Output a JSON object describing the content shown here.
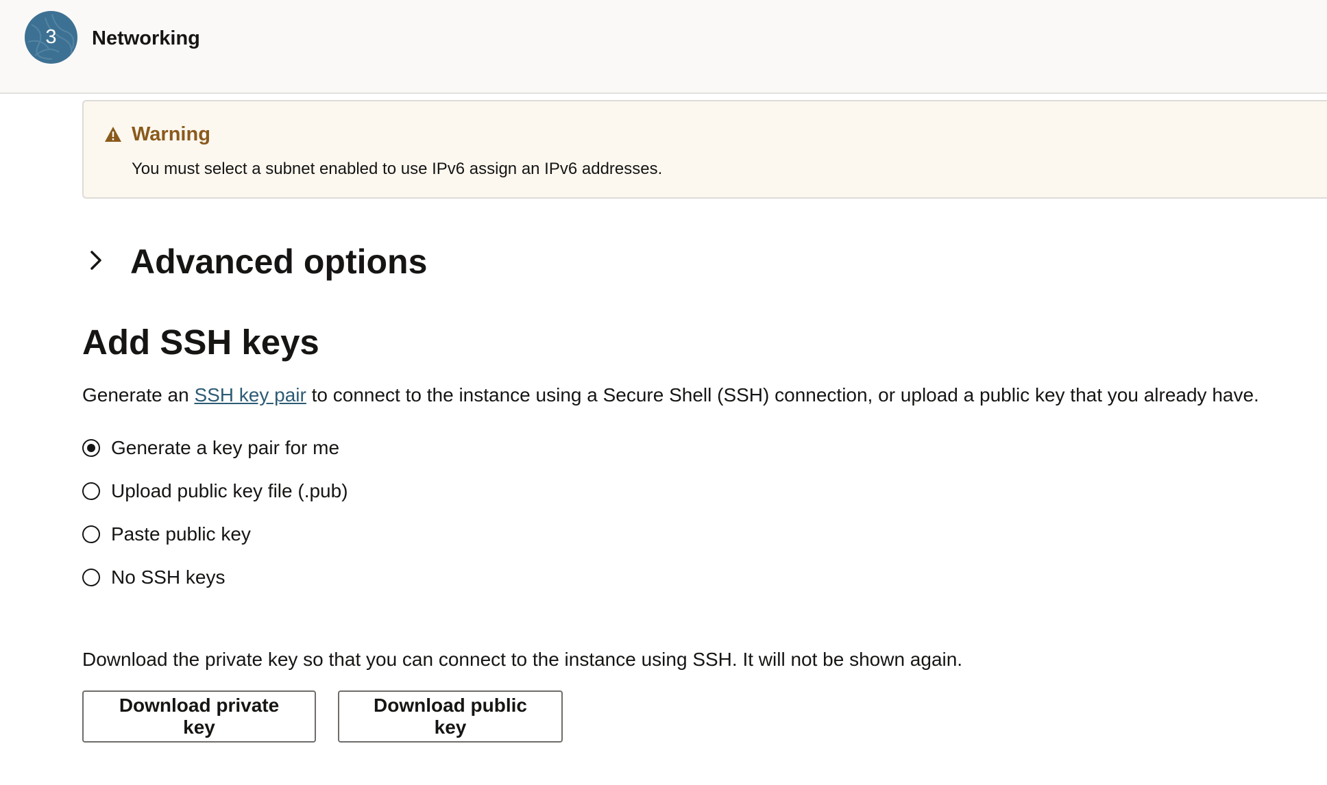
{
  "header": {
    "step_number": "3",
    "step_title": "Networking"
  },
  "warning": {
    "icon": "warning-triangle-icon",
    "title": "Warning",
    "message": "You must select a subnet enabled to use IPv6 assign an IPv6 addresses."
  },
  "advanced": {
    "icon": "chevron-right-icon",
    "title": "Advanced options"
  },
  "ssh": {
    "title": "Add SSH keys",
    "desc_before": "Generate an ",
    "desc_link": "SSH key pair",
    "desc_after": " to connect to the instance using a Secure Shell (SSH) connection, or upload a public key that you already have.",
    "options": [
      {
        "label": "Generate a key pair for me",
        "selected": true
      },
      {
        "label": "Upload public key file (.pub)",
        "selected": false
      },
      {
        "label": "Paste public key",
        "selected": false
      },
      {
        "label": "No SSH keys",
        "selected": false
      }
    ],
    "download_note": "Download the private key so that you can connect to the instance using SSH. It will not be shown again.",
    "download_private_label": "Download private key",
    "download_public_label": "Download public key"
  },
  "colors": {
    "step_circle": "#3d7193",
    "warning_title": "#8a5a1c",
    "warning_bg": "#fcf8f0",
    "link": "#2c5b75",
    "text": "#161513"
  }
}
